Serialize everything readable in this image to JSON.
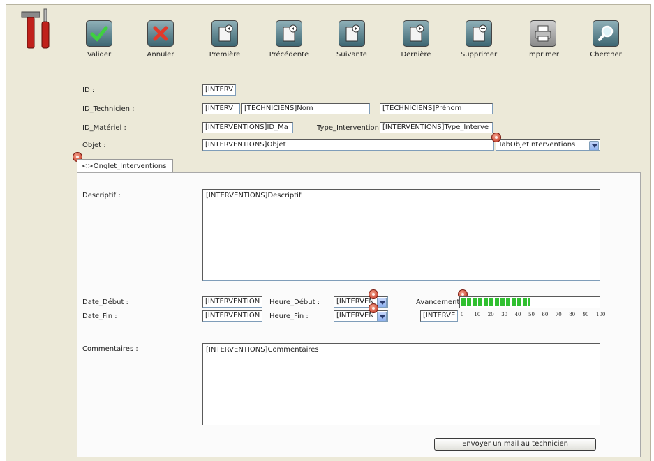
{
  "toolbar": {
    "buttons": [
      {
        "label": "Valider",
        "icon": "checkmark-icon"
      },
      {
        "label": "Annuler",
        "icon": "cross-icon"
      },
      {
        "label": "Première",
        "icon": "first-record-icon"
      },
      {
        "label": "Précédente",
        "icon": "previous-record-icon"
      },
      {
        "label": "Suivante",
        "icon": "next-record-icon"
      },
      {
        "label": "Dernière",
        "icon": "last-record-icon"
      },
      {
        "label": "Supprimer",
        "icon": "delete-record-icon"
      },
      {
        "label": "Imprimer",
        "icon": "printer-icon"
      },
      {
        "label": "Chercher",
        "icon": "magnifier-icon"
      }
    ]
  },
  "form": {
    "id_label": "ID :",
    "id_value": "[INTERV",
    "tech_label": "ID_Technicien :",
    "tech_id_value": "[INTERV",
    "tech_nom_value": "[TECHNICIENS]Nom",
    "tech_prenom_value": "[TECHNICIENS]Prénom",
    "materiel_label": "ID_Matériel :",
    "materiel_value": "[INTERVENTIONS]ID_Ma",
    "type_label": "Type_Intervention",
    "type_value": "[INTERVENTIONS]Type_Interve",
    "objet_label": "Objet :",
    "objet_value": "[INTERVENTIONS]Objet",
    "objet_combo_value": "TabObjetInterventions"
  },
  "tab": {
    "label": "<>Onglet_Interventions",
    "descriptif_label": "Descriptif :",
    "descriptif_value": "[INTERVENTIONS]Descriptif",
    "date_debut_label": "Date_Début :",
    "date_debut_value": "[INTERVENTION",
    "heure_debut_label": "Heure_Début :",
    "heure_debut_value": "[INTERVEN",
    "date_fin_label": "Date_Fin :",
    "date_fin_value": "[INTERVENTION",
    "heure_fin_label": "Heure_Fin :",
    "heure_fin_value": "[INTERVEN",
    "avancement_label": "Avancement :",
    "avancement_value": "[INTERVE",
    "avancement_percent": 50,
    "scale_ticks": [
      "0",
      "10",
      "20",
      "30",
      "40",
      "50",
      "60",
      "70",
      "80",
      "90",
      "100"
    ],
    "commentaires_label": "Commentaires :",
    "commentaires_value": "[INTERVENTIONS]Commentaires",
    "mail_button": "Envoyer un mail au technicien"
  },
  "colors": {
    "window_bg": "#ece9d8",
    "progress_fill": "#30c030",
    "field_border": "#7f9db9"
  }
}
